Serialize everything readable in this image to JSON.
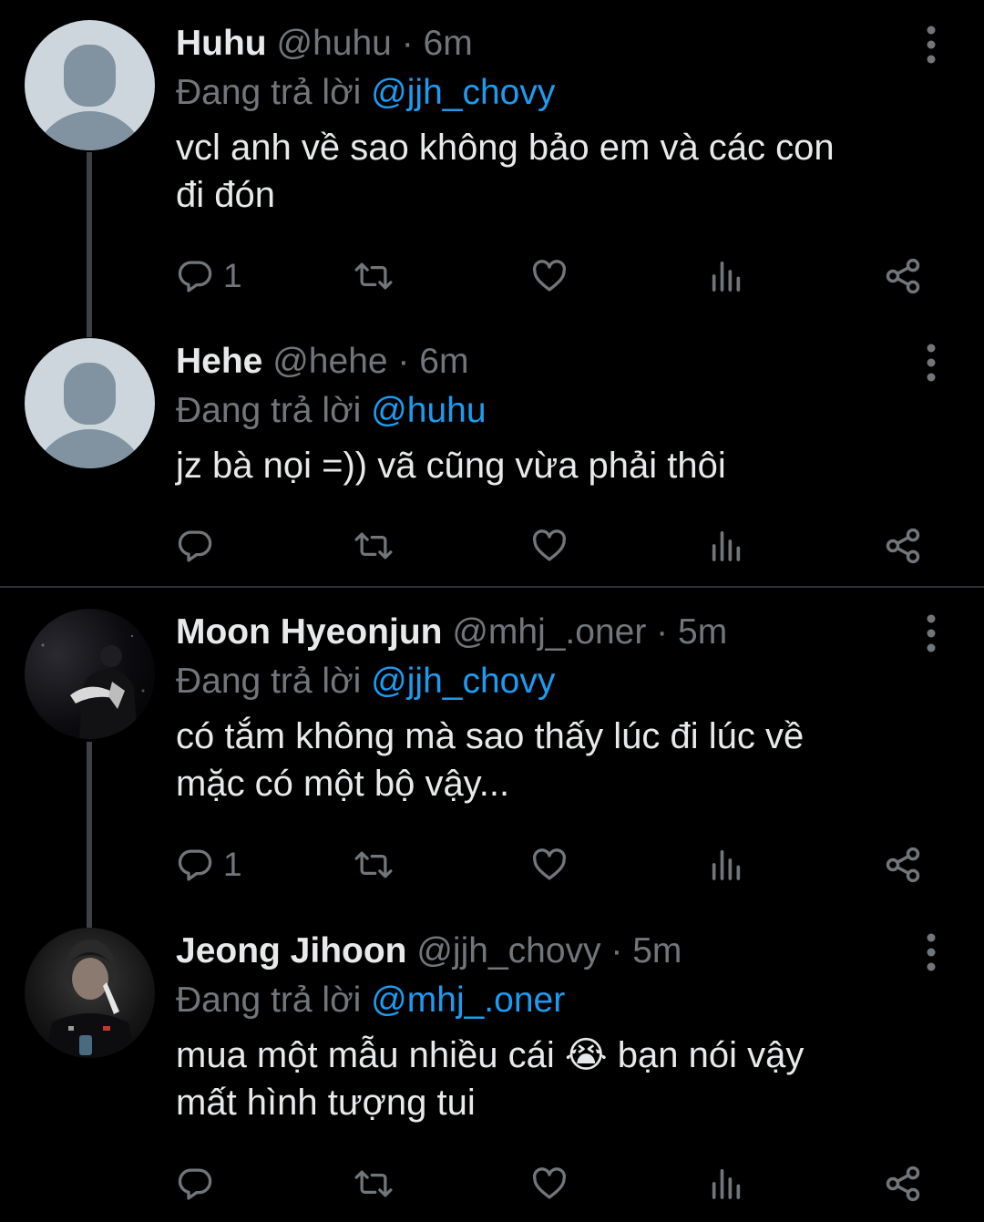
{
  "colors": {
    "background": "#000000",
    "text": "#e7e9ea",
    "secondary": "#71767b",
    "mention": "#1d9bf0",
    "thread_line": "#3e4144"
  },
  "icons": [
    "reply-icon",
    "retweet-icon",
    "like-icon",
    "views-icon",
    "share-icon",
    "more-icon"
  ],
  "tweets": [
    {
      "name": "Huhu",
      "handle": "@huhu",
      "separator": "·",
      "time": "6m",
      "replying_prefix": "Đang trả lời",
      "replying_to": "@jjh_chovy",
      "text_lines": [
        "vcl anh về sao không bảo em và các con",
        "đi đón"
      ],
      "reply_count": "1"
    },
    {
      "name": "Hehe",
      "handle": "@hehe",
      "separator": "·",
      "time": "6m",
      "replying_prefix": "Đang trả lời",
      "replying_to": "@huhu",
      "text_lines": [
        "jz bà nọi =)) vã cũng vừa phải thôi"
      ],
      "reply_count": ""
    },
    {
      "name": "Moon Hyeonjun",
      "handle": "@mhj_.oner",
      "separator": "·",
      "time": "5m",
      "replying_prefix": "Đang trả lời",
      "replying_to": "@jjh_chovy",
      "text_lines": [
        "có tắm không mà sao thấy lúc đi lúc về",
        "mặc có một bộ vậy..."
      ],
      "reply_count": "1"
    },
    {
      "name": "Jeong Jihoon",
      "handle": "@jjh_chovy",
      "separator": "·",
      "time": "5m",
      "replying_prefix": "Đang trả lời",
      "replying_to": "@mhj_.oner",
      "text_lines": [
        "mua một mẫu nhiều cái 😭 bạn nói vậy",
        "mất hình tượng tui"
      ],
      "reply_count": ""
    }
  ]
}
